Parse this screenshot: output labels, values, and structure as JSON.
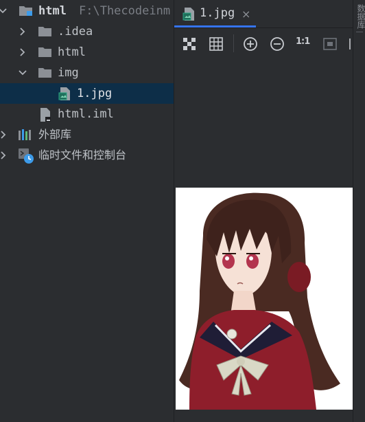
{
  "project_tree": {
    "root": {
      "name": "html",
      "path": "F:\\Thecodeinm"
    },
    "items": [
      {
        "label": ".idea"
      },
      {
        "label": "html"
      },
      {
        "label": "img"
      },
      {
        "label": "1.jpg"
      },
      {
        "label": "html.iml"
      },
      {
        "label": "外部库"
      },
      {
        "label": "临时文件和控制台"
      }
    ]
  },
  "editor": {
    "tab": {
      "label": "1.jpg",
      "close": "×"
    },
    "toolbar": {
      "actual_size_label": "1:1"
    }
  },
  "right_strip": {
    "label": "数据库"
  },
  "colors": {
    "background": "#2b2d30",
    "selection": "#0d2e48",
    "folder": "#8c9096",
    "accent": "#3574f0"
  },
  "icons": [
    "chevron-down-icon",
    "chevron-right-icon",
    "module-folder-icon",
    "folder-icon",
    "image-file-icon",
    "iml-file-icon",
    "library-icon",
    "scratches-console-icon",
    "chessboard-icon",
    "grid-icon",
    "zoom-in-icon",
    "zoom-out-icon",
    "fit-icon"
  ]
}
